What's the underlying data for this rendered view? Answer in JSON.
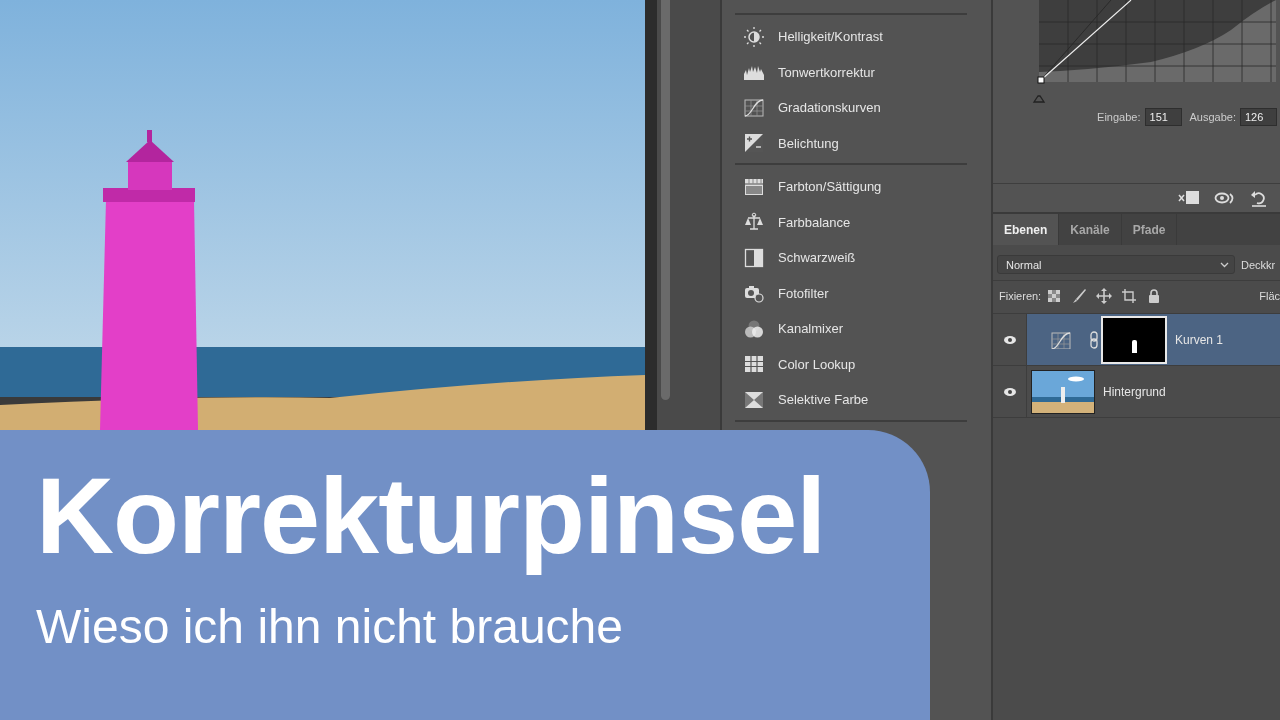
{
  "photo": {
    "kind": "lighthouse"
  },
  "adjustments_menu": {
    "groups": [
      [
        {
          "label": "Helligkeit/Kontrast",
          "kind": "brightness"
        },
        {
          "label": "Tonwertkorrektur",
          "kind": "levels"
        },
        {
          "label": "Gradationskurven",
          "kind": "curves"
        },
        {
          "label": "Belichtung",
          "kind": "exposure"
        }
      ],
      [
        {
          "label": "Farbton/Sättigung",
          "kind": "hue"
        },
        {
          "label": "Farbbalance",
          "kind": "balance"
        },
        {
          "label": "Schwarzweiß",
          "kind": "bw"
        },
        {
          "label": "Fotofilter",
          "kind": "camera"
        },
        {
          "label": "Kanalmixer",
          "kind": "mixer"
        },
        {
          "label": "Color Lookup",
          "kind": "grid"
        },
        {
          "label": "Selektive Farbe",
          "kind": "selective"
        }
      ]
    ]
  },
  "curves": {
    "input_label": "Eingabe:",
    "input_value": "151",
    "output_label": "Ausgabe:",
    "output_value": "126"
  },
  "layers_panel": {
    "tabs": [
      {
        "label": "Ebenen",
        "selected": true
      },
      {
        "label": "Kanäle",
        "selected": false
      },
      {
        "label": "Pfade",
        "selected": false
      }
    ],
    "blend_mode": "Normal",
    "opacity_label": "Deckkr",
    "lock_label": "Fixieren:",
    "fill_label": "Fläc",
    "layers": [
      {
        "name": "Kurven 1",
        "kind": "adjustment",
        "selected": true,
        "visible": true
      },
      {
        "name": "Hintergrund",
        "kind": "image",
        "selected": false,
        "visible": true
      }
    ]
  },
  "title_card": {
    "title": "Korrekturpinsel",
    "subtitle": "Wieso ich ihn nicht brauche"
  }
}
